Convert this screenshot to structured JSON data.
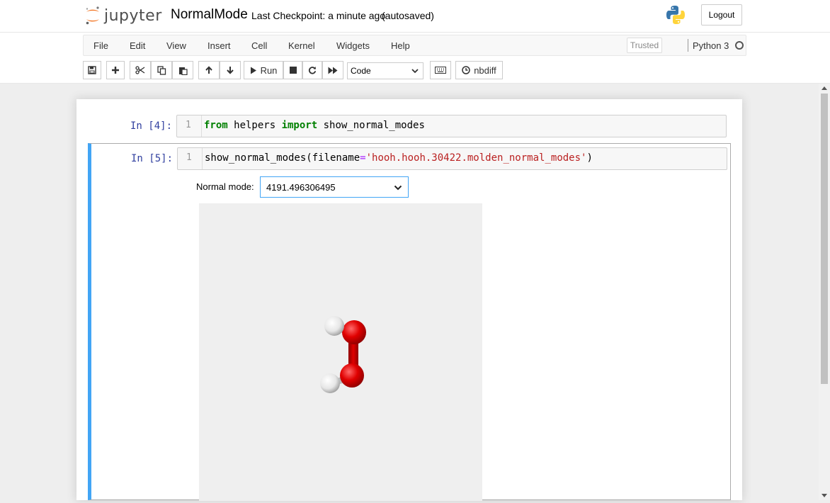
{
  "header": {
    "logo_text": "jupyter",
    "notebook_name": "NormalMode",
    "checkpoint": "Last Checkpoint: a minute ago",
    "autosave_status": "(autosaved)",
    "logout_label": "Logout"
  },
  "menubar": {
    "items": [
      "File",
      "Edit",
      "View",
      "Insert",
      "Cell",
      "Kernel",
      "Widgets",
      "Help"
    ],
    "trusted_label": "Trusted",
    "kernel_name": "Python 3"
  },
  "toolbar": {
    "run_label": "Run",
    "cell_type": "Code",
    "nbdiff_label": "nbdiff",
    "icons": [
      "save-icon",
      "plus-icon",
      "scissors-icon",
      "copy-icon",
      "paste-icon",
      "arrow-up-icon",
      "arrow-down-icon",
      "play-icon",
      "stop-icon",
      "restart-icon",
      "fast-forward-icon",
      "keyboard-icon",
      "clock-icon"
    ]
  },
  "cells": [
    {
      "prompt": "In [4]:",
      "line_number": "1",
      "code_parts": [
        {
          "text": "from",
          "cls": "kw"
        },
        {
          "text": " helpers ",
          "cls": ""
        },
        {
          "text": "import",
          "cls": "kw"
        },
        {
          "text": " show_normal_modes",
          "cls": ""
        }
      ]
    },
    {
      "prompt": "In [5]:",
      "line_number": "1",
      "code_parts": [
        {
          "text": "show_normal_modes(filename",
          "cls": ""
        },
        {
          "text": "=",
          "cls": "op"
        },
        {
          "text": "'hooh.hooh.30422.molden_normal_modes'",
          "cls": "str"
        },
        {
          "text": ")",
          "cls": ""
        }
      ],
      "widget": {
        "label": "Normal mode:",
        "selected_value": "4191.496306495"
      }
    }
  ],
  "colors": {
    "prompt": "#303f9f",
    "keyword": "#008000",
    "string": "#ba2121",
    "operator": "#aa22ff",
    "selected_cell_border": "#42a5f5",
    "oxygen": "#e00000",
    "hydrogen": "#eeeeee"
  }
}
